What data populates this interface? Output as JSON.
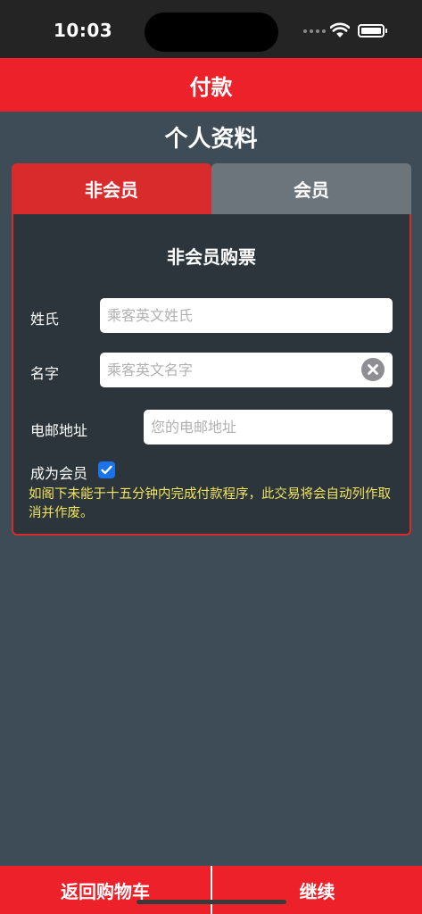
{
  "status_bar": {
    "time": "10:03"
  },
  "nav": {
    "title": "付款"
  },
  "section_title": "个人资料",
  "tabs": [
    {
      "label": "非会员",
      "selected": true
    },
    {
      "label": "会员",
      "selected": false
    }
  ],
  "form": {
    "heading": "非会员购票",
    "surname": {
      "label": "姓氏",
      "placeholder": "乘客英文姓氏",
      "value": ""
    },
    "given_name": {
      "label": "名字",
      "placeholder": "乘客英文名字",
      "value": ""
    },
    "email": {
      "label": "电邮地址",
      "placeholder": "您的电邮地址",
      "value": ""
    },
    "become_member": {
      "label": "成为会员",
      "checked": true
    },
    "notice": "如阁下未能于十五分钟内完成付款程序，此交易将会自动列作取消并作废。"
  },
  "bottom_bar": {
    "back_label": "返回购物车",
    "continue_label": "继续"
  },
  "colors": {
    "brand_red": "#ed2129",
    "tab_active": "#d92b2b",
    "tab_inactive": "#6d757c",
    "background": "#3d4c56",
    "panel": "#2b353b",
    "notice_text": "#f2e45c",
    "checkbox": "#1a73e8"
  },
  "icons": {
    "wifi": "wifi-icon",
    "battery": "battery-icon",
    "clear": "clear-icon",
    "checkmark": "checkmark-icon"
  }
}
